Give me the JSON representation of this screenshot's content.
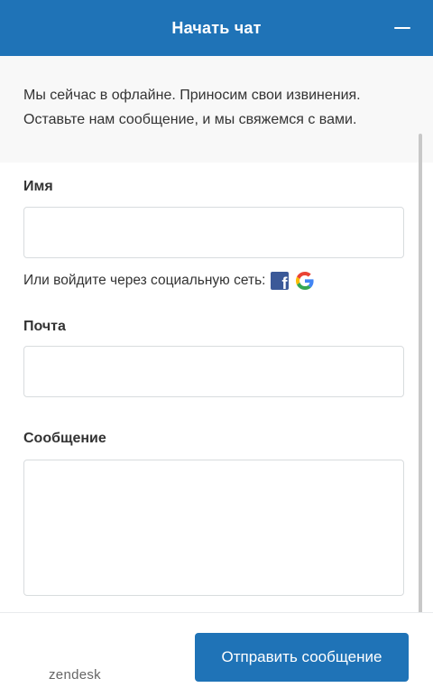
{
  "header": {
    "title": "Начать чат",
    "minimize_icon": "minimize-icon"
  },
  "notice": {
    "text": "Мы сейчас в офлайне. Приносим свои извинения. Оставьте нам сообщение, и мы свяжемся с вами."
  },
  "form": {
    "name_label": "Имя",
    "name_value": "",
    "social_text": "Или войдите через социальную сеть:",
    "social_icons": [
      "facebook-icon",
      "google-icon"
    ],
    "email_label": "Почта",
    "email_value": "",
    "message_label": "Сообщение",
    "message_value": ""
  },
  "footer": {
    "brand": "zendesk",
    "send_label": "Отправить сообщение"
  },
  "colors": {
    "brand_blue": "#1f73b7",
    "facebook_blue": "#3b5998",
    "notice_bg": "#f8f8f8"
  }
}
